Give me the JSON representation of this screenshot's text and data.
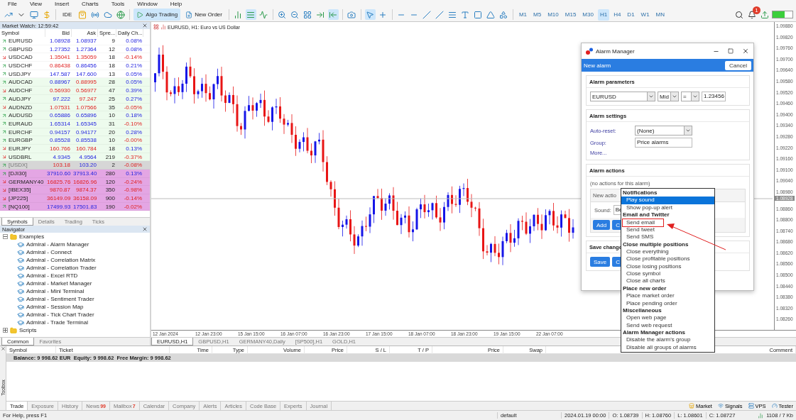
{
  "menu": [
    "File",
    "View",
    "Insert",
    "Charts",
    "Tools",
    "Window",
    "Help"
  ],
  "toolbar": {
    "ide": "IDE",
    "algo_trading": "Algo Trading",
    "new_order": "New Order",
    "timeframes": [
      {
        "label": "M1",
        "selected": false
      },
      {
        "label": "M5",
        "selected": false
      },
      {
        "label": "M10",
        "selected": false
      },
      {
        "label": "M15",
        "selected": false
      },
      {
        "label": "M30",
        "selected": false
      },
      {
        "label": "H1",
        "selected": true
      },
      {
        "label": "H4",
        "selected": false
      },
      {
        "label": "D1",
        "selected": false
      },
      {
        "label": "W1",
        "selected": false
      },
      {
        "label": "MN",
        "selected": false
      }
    ],
    "notification_count": "1"
  },
  "market_watch": {
    "title": "Market Watch: 12:59:42",
    "columns": [
      "Symbol",
      "Bid",
      "Ask",
      "Spre...",
      "Daily Ch..."
    ],
    "rows": [
      {
        "symbol": "EURUSD",
        "trend_up": true,
        "bid": "1.08928",
        "bid_up": true,
        "ask": "1.08937",
        "ask_up": true,
        "spread": "9",
        "change": "0.08%",
        "change_up": true,
        "color": "#ffffff",
        "disabled": false
      },
      {
        "symbol": "GBPUSD",
        "trend_up": true,
        "bid": "1.27352",
        "bid_up": true,
        "ask": "1.27364",
        "ask_up": true,
        "spread": "12",
        "change": "0.08%",
        "change_up": true,
        "color": "#ffffff",
        "disabled": false
      },
      {
        "symbol": "USDCAD",
        "trend_up": false,
        "bid": "1.35041",
        "bid_up": false,
        "ask": "1.35059",
        "ask_up": false,
        "spread": "18",
        "change": "-0.14%",
        "change_up": false,
        "color": "#ffffff",
        "disabled": false
      },
      {
        "symbol": "USDCHF",
        "trend_up": true,
        "bid": "0.86438",
        "bid_up": false,
        "ask": "0.86456",
        "ask_up": true,
        "spread": "18",
        "change": "0.21%",
        "change_up": true,
        "color": "#ffffff",
        "disabled": false
      },
      {
        "symbol": "USDJPY",
        "trend_up": true,
        "bid": "147.587",
        "bid_up": true,
        "ask": "147.600",
        "ask_up": true,
        "spread": "13",
        "change": "0.05%",
        "change_up": true,
        "color": "#ffffff",
        "disabled": false
      },
      {
        "symbol": "AUDCAD",
        "trend_up": true,
        "bid": "0.88967",
        "bid_up": true,
        "ask": "0.88995",
        "ask_up": false,
        "spread": "28",
        "change": "0.05%",
        "change_up": true,
        "color": "#edfbed",
        "disabled": false
      },
      {
        "symbol": "AUDCHF",
        "trend_up": false,
        "bid": "0.56930",
        "bid_up": false,
        "ask": "0.56977",
        "ask_up": false,
        "spread": "47",
        "change": "0.39%",
        "change_up": true,
        "color": "#edfbed",
        "disabled": false
      },
      {
        "symbol": "AUDJPY",
        "trend_up": true,
        "bid": "97.222",
        "bid_up": true,
        "ask": "97.247",
        "ask_up": false,
        "spread": "25",
        "change": "0.27%",
        "change_up": true,
        "color": "#edfbed",
        "disabled": false
      },
      {
        "symbol": "AUDNZD",
        "trend_up": false,
        "bid": "1.07531",
        "bid_up": false,
        "ask": "1.07566",
        "ask_up": false,
        "spread": "35",
        "change": "-0.05%",
        "change_up": false,
        "color": "#edfbed",
        "disabled": false
      },
      {
        "symbol": "AUDUSD",
        "trend_up": true,
        "bid": "0.65886",
        "bid_up": true,
        "ask": "0.65896",
        "ask_up": true,
        "spread": "10",
        "change": "0.18%",
        "change_up": true,
        "color": "#edfbed",
        "disabled": false
      },
      {
        "symbol": "EURAUD",
        "trend_up": true,
        "bid": "1.65314",
        "bid_up": true,
        "ask": "1.65345",
        "ask_up": true,
        "spread": "31",
        "change": "-0.10%",
        "change_up": false,
        "color": "#edfbed",
        "disabled": false
      },
      {
        "symbol": "EURCHF",
        "trend_up": true,
        "bid": "0.94157",
        "bid_up": true,
        "ask": "0.94177",
        "ask_up": true,
        "spread": "20",
        "change": "0.28%",
        "change_up": true,
        "color": "#edfbed",
        "disabled": false
      },
      {
        "symbol": "EURGBP",
        "trend_up": true,
        "bid": "0.85528",
        "bid_up": true,
        "ask": "0.85538",
        "ask_up": true,
        "spread": "10",
        "change": "-0.00%",
        "change_up": false,
        "color": "#edfbed",
        "disabled": false
      },
      {
        "symbol": "EURJPY",
        "trend_up": false,
        "bid": "160.766",
        "bid_up": false,
        "ask": "160.784",
        "ask_up": false,
        "spread": "18",
        "change": "0.13%",
        "change_up": true,
        "color": "#edfbed",
        "disabled": false
      },
      {
        "symbol": "USDBRL",
        "trend_up": false,
        "bid": "4.9345",
        "bid_up": true,
        "ask": "4.9564",
        "ask_up": true,
        "spread": "219",
        "change": "-0.37%",
        "change_up": false,
        "color": "#edfbed",
        "disabled": false
      },
      {
        "symbol": "[USDX]",
        "trend_up": true,
        "bid": "103.18",
        "bid_up": false,
        "ask": "103.20",
        "ask_up": true,
        "spread": "2",
        "change": "-0.08%",
        "change_up": false,
        "color": "#d6d6d6",
        "disabled": true
      },
      {
        "symbol": "[DJI30]",
        "trend_up": true,
        "bid": "37910.60",
        "bid_up": true,
        "ask": "37913.40",
        "ask_up": true,
        "spread": "280",
        "change": "0.13%",
        "change_up": true,
        "color": "#e4a6e4",
        "disabled": false
      },
      {
        "symbol": "GERMANY40",
        "trend_up": false,
        "bid": "16825.76",
        "bid_up": false,
        "ask": "16826.96",
        "ask_up": false,
        "spread": "120",
        "change": "-0.24%",
        "change_up": false,
        "color": "#e4a6e4",
        "disabled": false
      },
      {
        "symbol": "[IBEX35]",
        "trend_up": false,
        "bid": "9870.87",
        "bid_up": false,
        "ask": "9874.37",
        "ask_up": false,
        "spread": "350",
        "change": "-0.98%",
        "change_up": false,
        "color": "#e4a6e4",
        "disabled": false
      },
      {
        "symbol": "[JP225]",
        "trend_up": false,
        "bid": "36149.09",
        "bid_up": false,
        "ask": "36158.09",
        "ask_up": false,
        "spread": "900",
        "change": "-0.14%",
        "change_up": false,
        "color": "#e4a6e4",
        "disabled": false
      },
      {
        "symbol": "[NQ100]",
        "trend_up": true,
        "bid": "17499.93",
        "bid_up": true,
        "ask": "17501.83",
        "ask_up": true,
        "spread": "190",
        "change": "-0.02%",
        "change_up": false,
        "color": "#e4a6e4",
        "disabled": false
      }
    ],
    "tabs": [
      {
        "label": "Symbols",
        "selected": true
      },
      {
        "label": "Details",
        "selected": false
      },
      {
        "label": "Trading",
        "selected": false
      },
      {
        "label": "Ticks",
        "selected": false
      }
    ]
  },
  "navigator": {
    "title": "Navigator",
    "tree": [
      {
        "label": "Examples",
        "kind": "folder",
        "expanded": true,
        "children": [
          {
            "label": "Admiral - Alarm Manager",
            "kind": "program"
          },
          {
            "label": "Admiral - Connect",
            "kind": "program"
          },
          {
            "label": "Admiral - Correlation Matrix",
            "kind": "program"
          },
          {
            "label": "Admiral - Correlation Trader",
            "kind": "program"
          },
          {
            "label": "Admiral - Excel RTD",
            "kind": "program"
          },
          {
            "label": "Admiral - Market Manager",
            "kind": "program"
          },
          {
            "label": "Admiral - Mini Terminal",
            "kind": "program"
          },
          {
            "label": "Admiral - Sentiment Trader",
            "kind": "program"
          },
          {
            "label": "Admiral - Session Map",
            "kind": "program"
          },
          {
            "label": "Admiral - Tick Chart Trader",
            "kind": "program"
          },
          {
            "label": "Admiral - Trade Terminal",
            "kind": "program"
          }
        ]
      },
      {
        "label": "Scripts",
        "kind": "folder",
        "expanded": false
      }
    ],
    "tabs": [
      {
        "label": "Common",
        "selected": true
      },
      {
        "label": "Favorites",
        "selected": false
      }
    ]
  },
  "chart": {
    "title": "EURUSD, H1:  Euro vs US Dollar",
    "current_price": "1.08928",
    "price_ticks": [
      "1.09880",
      "1.09820",
      "1.09760",
      "1.09700",
      "1.09640",
      "1.09580",
      "1.09520",
      "1.09460",
      "1.09400",
      "1.09340",
      "1.09280",
      "1.09220",
      "1.09160",
      "1.09100",
      "1.09040",
      "1.08980",
      "1.08860",
      "1.08800",
      "1.08740",
      "1.08680",
      "1.08620",
      "1.08560",
      "1.08500",
      "1.08440",
      "1.08380",
      "1.08320",
      "1.08260"
    ],
    "time_ticks": [
      "12 Jan 2024",
      "12 Jan 23:00",
      "15 Jan 15:00",
      "16 Jan 07:00",
      "16 Jan 23:00",
      "17 Jan 15:00",
      "18 Jan 07:00",
      "18 Jan 23:00",
      "19 Jan 15:00",
      "22 Jan 07:00"
    ],
    "tabs": [
      {
        "label": "EURUSD,H1",
        "selected": true
      },
      {
        "label": "GBPUSD,H1",
        "selected": false
      },
      {
        "label": "GERMANY40,Daily",
        "selected": false
      },
      {
        "label": "[SP500],H1",
        "selected": false
      },
      {
        "label": "GOLD,H1",
        "selected": false
      }
    ]
  },
  "alarm_manager": {
    "title": "Alarm Manager",
    "header": "New alarm",
    "cancel": "Cancel",
    "parameters": {
      "title": "Alarm parameters",
      "symbol": "EURUSD",
      "price_type": "Mid",
      "operator": "=",
      "value": "1.23456"
    },
    "settings": {
      "title": "Alarm settings",
      "auto_reset_label": "Auto-reset:",
      "auto_reset": "(None)",
      "group_label": "Group:",
      "group": "Price alarms",
      "more": "More..."
    },
    "actions": {
      "title": "Alarm actions",
      "empty": "(no actions for this alarm)",
      "new_action": "New actio",
      "sound_label": "Sound:",
      "sound": "Be",
      "add": "Add",
      "cancel": "C"
    },
    "save": {
      "title": "Save change",
      "save": "Save",
      "cancel": "C"
    }
  },
  "action_menu": [
    {
      "kind": "group",
      "label": "Notifications"
    },
    {
      "kind": "item",
      "label": "Play sound",
      "selected": true,
      "boxed": false
    },
    {
      "kind": "item",
      "label": "Show pop-up alert",
      "selected": false,
      "boxed": false
    },
    {
      "kind": "group",
      "label": "Email and Twitter"
    },
    {
      "kind": "item",
      "label": "Send email",
      "selected": false,
      "boxed": true
    },
    {
      "kind": "item",
      "label": "Send tweet",
      "selected": false,
      "boxed": false
    },
    {
      "kind": "item",
      "label": "Send SMS",
      "selected": false,
      "boxed": false
    },
    {
      "kind": "group",
      "label": "Close multiple positions"
    },
    {
      "kind": "item",
      "label": "Close everything",
      "selected": false,
      "boxed": false
    },
    {
      "kind": "item",
      "label": "Close profitable positions",
      "selected": false,
      "boxed": false
    },
    {
      "kind": "item",
      "label": "Close losing positions",
      "selected": false,
      "boxed": false
    },
    {
      "kind": "item",
      "label": "Close symbol",
      "selected": false,
      "boxed": false
    },
    {
      "kind": "item",
      "label": "Close all charts",
      "selected": false,
      "boxed": false
    },
    {
      "kind": "group",
      "label": "Place new order"
    },
    {
      "kind": "item",
      "label": "Place market order",
      "selected": false,
      "boxed": false
    },
    {
      "kind": "item",
      "label": "Place pending order",
      "selected": false,
      "boxed": false
    },
    {
      "kind": "group",
      "label": "Miscellaneous"
    },
    {
      "kind": "item",
      "label": "Open web page",
      "selected": false,
      "boxed": false
    },
    {
      "kind": "item",
      "label": "Send web request",
      "selected": false,
      "boxed": false
    },
    {
      "kind": "group",
      "label": "Alarm Manager actions"
    },
    {
      "kind": "item",
      "label": "Disable the alarm's group",
      "selected": false,
      "boxed": false
    },
    {
      "kind": "item",
      "label": "Disable all groups of alarms",
      "selected": false,
      "boxed": false
    }
  ],
  "toolbox": {
    "label": "Toolbox",
    "columns": [
      "Symbol",
      "Ticket",
      "Time",
      "Type",
      "Volume",
      "Price",
      "S / L",
      "T / P",
      "Price",
      "Swap",
      "Comment"
    ],
    "balance": "Balance: 9 998.62 EUR  Equity: 9 998.62  Free Margin: 9 998.62",
    "tabs": [
      {
        "label": "Trade",
        "selected": true
      },
      {
        "label": "Exposure",
        "selected": false
      },
      {
        "label": "History",
        "selected": false
      },
      {
        "label": "News",
        "badge": "99",
        "selected": false
      },
      {
        "label": "Mailbox",
        "badge": "7",
        "selected": false
      },
      {
        "label": "Calendar",
        "selected": false
      },
      {
        "label": "Company",
        "selected": false
      },
      {
        "label": "Alerts",
        "selected": false
      },
      {
        "label": "Articles",
        "selected": false
      },
      {
        "label": "Code Base",
        "selected": false
      },
      {
        "label": "Experts",
        "selected": false
      },
      {
        "label": "Journal",
        "selected": false
      }
    ],
    "services": [
      {
        "label": "Market",
        "kind": "market"
      },
      {
        "label": "Signals",
        "kind": "signals"
      },
      {
        "label": "VPS",
        "kind": "vps"
      },
      {
        "label": "Tester",
        "kind": "tester"
      }
    ]
  },
  "status_bar": {
    "help": "For Help, press F1",
    "profile": "default",
    "time": "2024.01.19 00:00",
    "open": "O: 1.08739",
    "high": "H: 1.08760",
    "low": "L: 1.08601",
    "close": "C: 1.08727",
    "traffic": "1108 / 7 Kb"
  }
}
